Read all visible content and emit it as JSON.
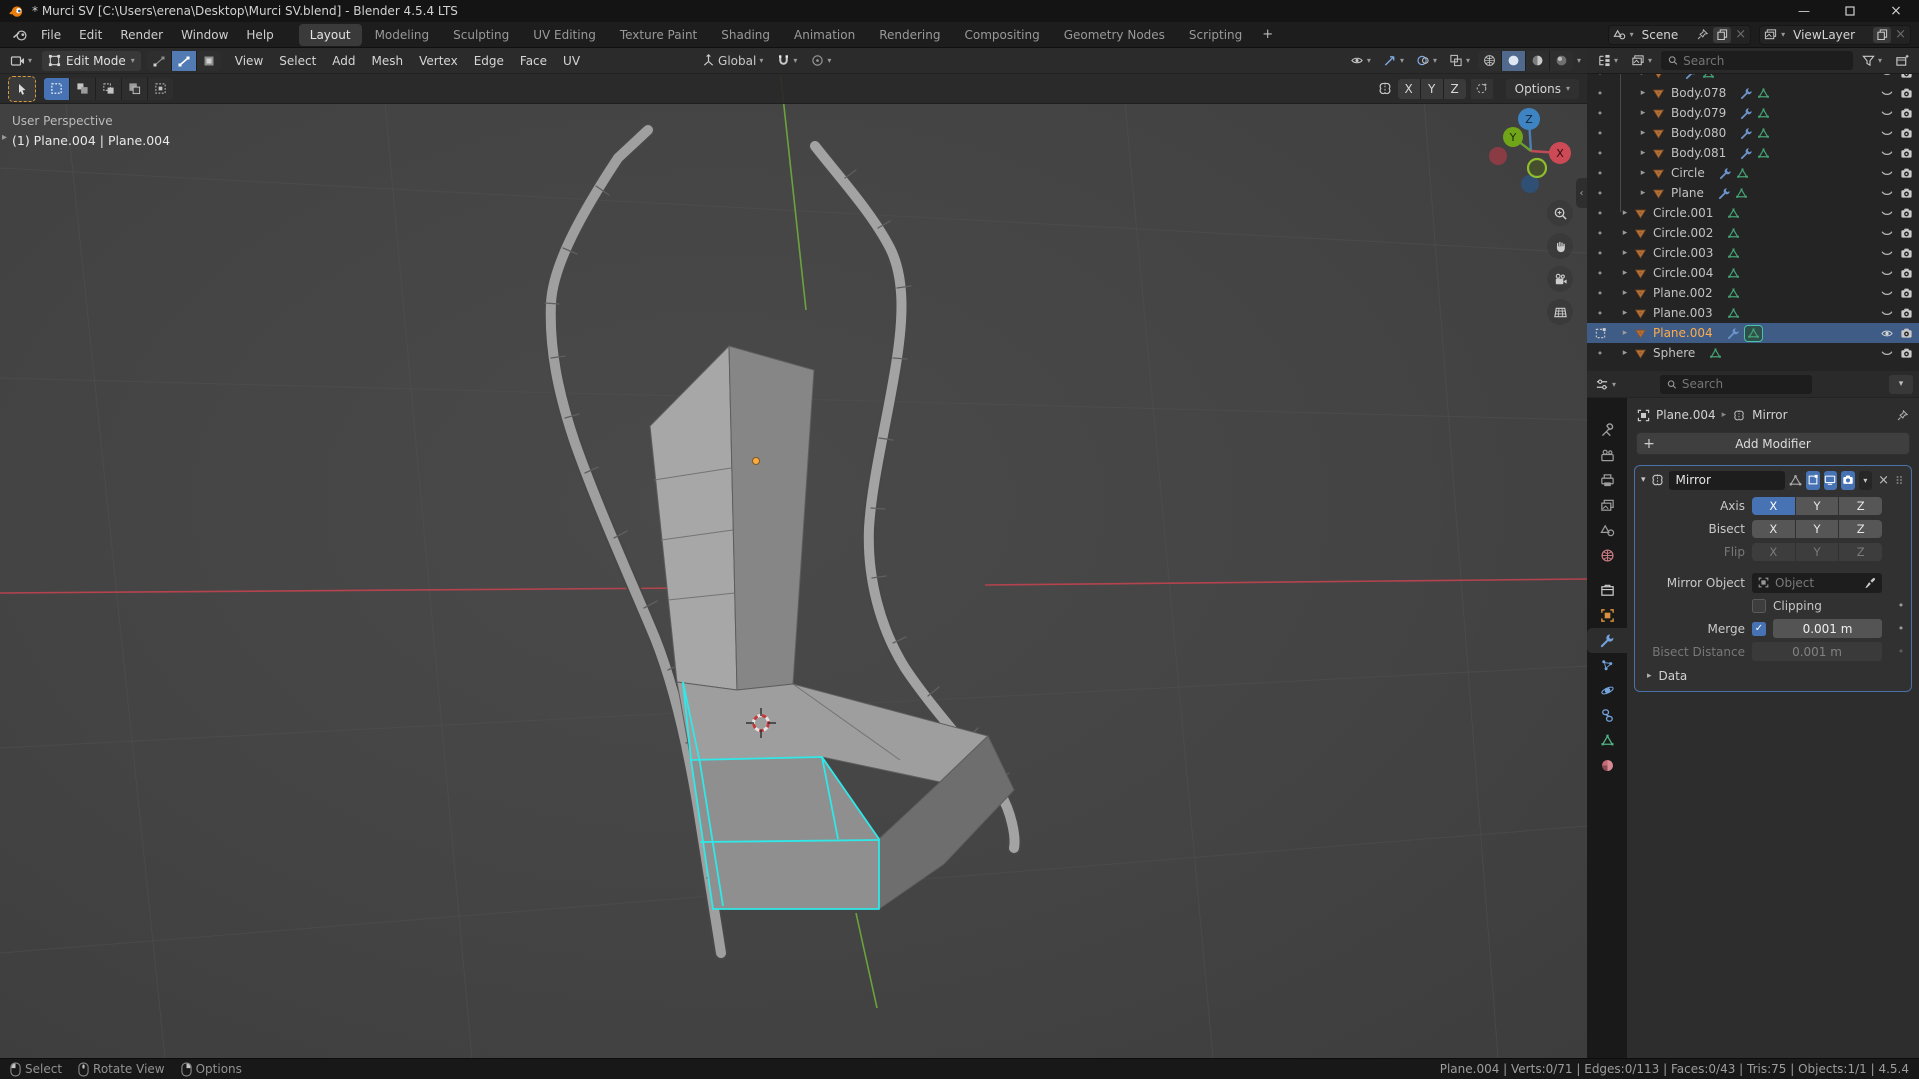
{
  "window": {
    "title": "* Murci SV [C:\\Users\\erena\\Desktop\\Murci SV.blend] - Blender 4.5.4 LTS"
  },
  "topbar": {
    "menus": [
      "File",
      "Edit",
      "Render",
      "Window",
      "Help"
    ],
    "workspace_tabs": [
      "Layout",
      "Modeling",
      "Sculpting",
      "UV Editing",
      "Texture Paint",
      "Shading",
      "Animation",
      "Rendering",
      "Compositing",
      "Geometry Nodes",
      "Scripting"
    ],
    "active_tab": "Layout",
    "new_tab_label": "+",
    "scene_selector": {
      "value": "Scene"
    },
    "view_layer_selector": {
      "value": "ViewLayer"
    }
  },
  "viewport": {
    "header": {
      "mode": "Edit Mode",
      "menus": [
        "View",
        "Select",
        "Add",
        "Mesh",
        "Vertex",
        "Edge",
        "Face",
        "UV"
      ],
      "orientation": "Global"
    },
    "tool_options": {
      "mirror_axes": [
        "X",
        "Y",
        "Z"
      ],
      "options_label": "Options"
    },
    "overlay": {
      "line1": "User Perspective",
      "line2": "(1) Plane.004 | Plane.004"
    },
    "gizmo": {
      "x": "X",
      "y": "Y",
      "z": "Z"
    }
  },
  "outliner": {
    "search_placeholder": "Search",
    "partial_top_row": {
      "indent": 2,
      "modifier": true,
      "hidden": true
    },
    "items": [
      {
        "name": "Body.078",
        "indent": 2,
        "modifier": true,
        "hidden": true
      },
      {
        "name": "Body.079",
        "indent": 2,
        "modifier": true,
        "hidden": true
      },
      {
        "name": "Body.080",
        "indent": 2,
        "modifier": true,
        "hidden": true
      },
      {
        "name": "Body.081",
        "indent": 2,
        "modifier": true,
        "hidden": true
      },
      {
        "name": "Circle",
        "indent": 2,
        "modifier": true,
        "hidden": true
      },
      {
        "name": "Plane",
        "indent": 2,
        "modifier": true,
        "hidden": true
      },
      {
        "name": "Circle.001",
        "indent": 1,
        "modifier": false,
        "hidden": true
      },
      {
        "name": "Circle.002",
        "indent": 1,
        "modifier": false,
        "hidden": true
      },
      {
        "name": "Circle.003",
        "indent": 1,
        "modifier": false,
        "hidden": true
      },
      {
        "name": "Circle.004",
        "indent": 1,
        "modifier": false,
        "hidden": true
      },
      {
        "name": "Plane.002",
        "indent": 1,
        "modifier": false,
        "hidden": true
      },
      {
        "name": "Plane.003",
        "indent": 1,
        "modifier": false,
        "hidden": true
      },
      {
        "name": "Plane.004",
        "indent": 1,
        "modifier": true,
        "hidden": false,
        "selected": true,
        "editing": true
      },
      {
        "name": "Sphere",
        "indent": 1,
        "modifier": false,
        "hidden": true
      }
    ]
  },
  "properties": {
    "search_placeholder": "Search",
    "breadcrumb": {
      "object": "Plane.004",
      "modifier": "Mirror"
    },
    "add_modifier_label": "Add Modifier",
    "tabs": [
      "tool",
      "render",
      "output",
      "view-layer",
      "scene",
      "world",
      "collection",
      "object",
      "modifiers",
      "particles",
      "physics",
      "constraints",
      "data",
      "material"
    ],
    "active_tab": "modifiers",
    "modifier_panel": {
      "name": "Mirror",
      "rows": {
        "axis": {
          "label": "Axis",
          "options": [
            "X",
            "Y",
            "Z"
          ],
          "active": [
            "X"
          ]
        },
        "bisect": {
          "label": "Bisect",
          "options": [
            "X",
            "Y",
            "Z"
          ],
          "active": []
        },
        "flip": {
          "label": "Flip",
          "options": [
            "X",
            "Y",
            "Z"
          ],
          "active": [],
          "disabled": true
        },
        "mirror_object": {
          "label": "Mirror Object",
          "placeholder": "Object"
        },
        "clipping": {
          "label": "Clipping",
          "checked": false
        },
        "merge": {
          "label": "Merge",
          "checked": true,
          "value": "0.001 m"
        },
        "bisect_distance": {
          "label": "Bisect Distance",
          "value": "0.001 m",
          "disabled": true
        },
        "data": {
          "label": "Data"
        }
      }
    }
  },
  "statusbar": {
    "hints": [
      {
        "button": "left",
        "label": "Select"
      },
      {
        "button": "middle",
        "label": "Rotate View"
      },
      {
        "button": "right",
        "label": "Options"
      }
    ],
    "stats": [
      "Plane.004",
      "Verts:0/71",
      "Edges:0/113",
      "Faces:0/43",
      "Tris:75",
      "Objects:1/1",
      "4.5.4"
    ]
  }
}
